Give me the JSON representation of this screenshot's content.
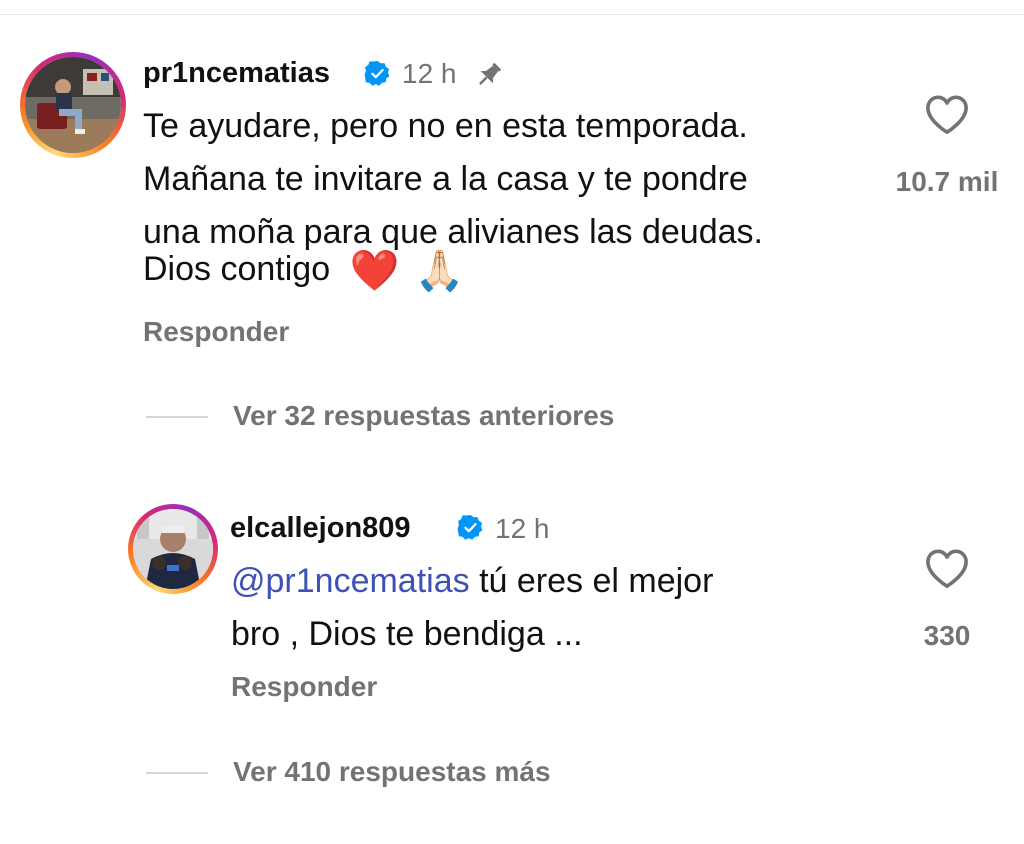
{
  "comments": [
    {
      "username": "pr1ncematias",
      "time": "12 h",
      "text_lines": [
        "Te ayudare, pero no en esta temporada.",
        "Mañana te invitare a la casa y te pondre",
        "una moña para que alivianes las deudas."
      ],
      "last_line": "Dios contigo",
      "emojis": [
        "❤️",
        "🙏🏻"
      ],
      "reply_label": "Responder",
      "likes": "10.7 mil",
      "pinned": true
    }
  ],
  "thread_view_previous": "Ver 32 respuestas anteriores",
  "reply": {
    "username": "elcallejon809",
    "time": "12 h",
    "mention": "@pr1ncematias",
    "text_line1_rest": " tú eres el mejor",
    "text_line2": "bro , Dios te bendiga ...",
    "reply_label": "Responder",
    "likes": "330"
  },
  "thread_view_more": "Ver 410 respuestas más",
  "colors": {
    "text": "#111111",
    "muted": "#737373",
    "mention": "#3f51b5",
    "verified": "#0095f6"
  },
  "icons": [
    "verified-badge-icon",
    "pin-icon",
    "heart-icon"
  ]
}
